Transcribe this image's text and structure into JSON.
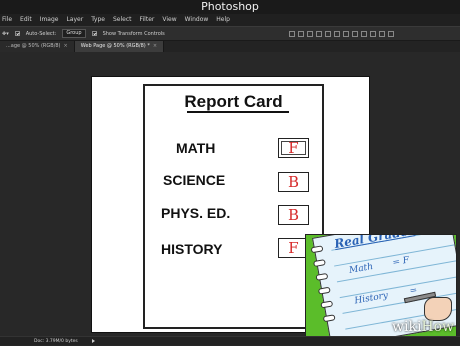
{
  "app": {
    "title": "Photoshop"
  },
  "menu": {
    "items": [
      "File",
      "Edit",
      "Image",
      "Layer",
      "Type",
      "Select",
      "Filter",
      "View",
      "Window",
      "Help"
    ]
  },
  "options": {
    "auto_select_label": "Auto-Select:",
    "group_value": "Group",
    "show_transform_label": "Show Transform Controls"
  },
  "tabs": [
    {
      "label": "...age @ 50% (RGB/8)",
      "close": "×"
    },
    {
      "label": "Web Page @ 50% (RGB/8) *",
      "close": "×"
    }
  ],
  "report_card": {
    "title": "Report Card",
    "rows": [
      {
        "subject": "MATH",
        "grade": "F"
      },
      {
        "subject": "SCIENCE",
        "grade": "B"
      },
      {
        "subject": "PHYS. ED.",
        "grade": "B"
      },
      {
        "subject": "HISTORY",
        "grade": "F"
      }
    ]
  },
  "inset_notebook": {
    "heading": "Real Grades",
    "line1_subject": "Math",
    "line1_grade": "= F",
    "line2_subject": "History",
    "line2_grade": "="
  },
  "watermark": {
    "part1": "wiki",
    "part2": "How"
  },
  "status": {
    "doc": "Doc: 3.79M/0 bytes"
  },
  "colors": {
    "grade_red": "#d62b2b",
    "inset_green": "#5bbd2a",
    "notebook_ink": "#2a62b5"
  }
}
